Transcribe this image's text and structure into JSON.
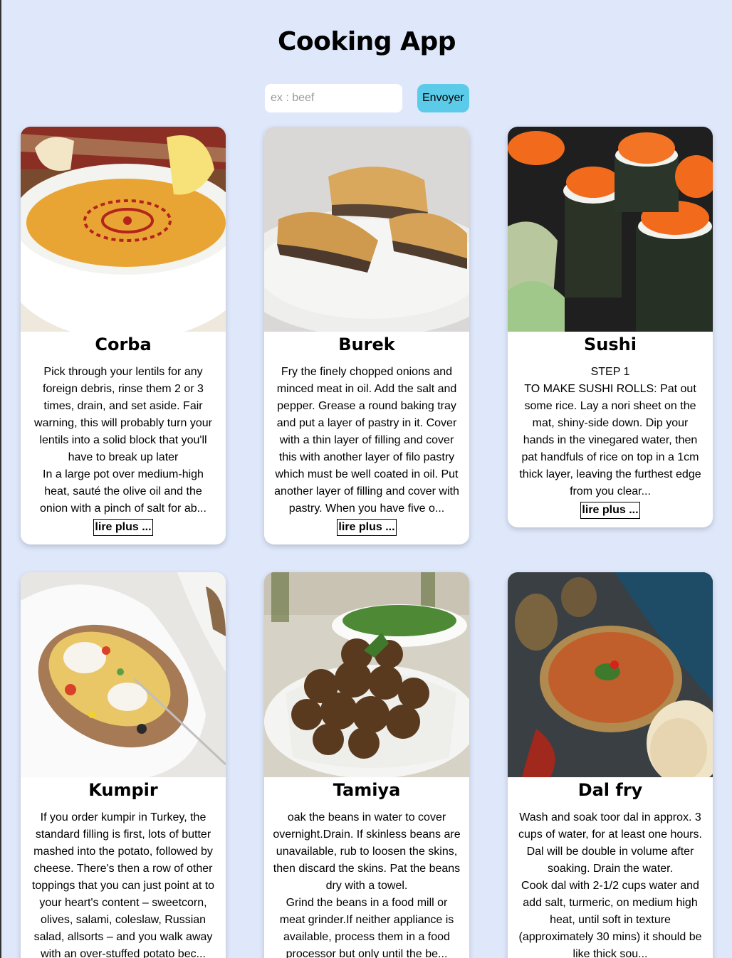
{
  "header": {
    "title": "Cooking App"
  },
  "search": {
    "placeholder": "ex : beef",
    "value": "",
    "button_label": "Envoyer"
  },
  "read_more_label": "lire plus ...",
  "recipes": [
    {
      "name": "Corba",
      "image": "lentil-soup-image",
      "text": "Pick through your lentils for any foreign debris, rinse them 2 or 3 times, drain, and set aside. Fair warning, this will probably turn your lentils into a solid block that you'll have to break up later\nIn a large pot over medium-high heat, sauté the olive oil and the onion with a pinch of salt for ab..."
    },
    {
      "name": "Burek",
      "image": "burek-pastry-image",
      "text": "Fry the finely chopped onions and minced meat in oil. Add the salt and pepper. Grease a round baking tray and put a layer of pastry in it. Cover with a thin layer of filling and cover this with another layer of filo pastry which must be well coated in oil. Put another layer of filling and cover with pastry. When you have five o..."
    },
    {
      "name": "Sushi",
      "image": "sushi-rolls-image",
      "text": "STEP 1\nTO MAKE SUSHI ROLLS: Pat out some rice. Lay a nori sheet on the mat, shiny-side down. Dip your hands in the vinegared water, then pat handfuls of rice on top in a 1cm thick layer, leaving the furthest edge from you clear..."
    },
    {
      "name": "Kumpir",
      "image": "kumpir-potato-image",
      "text": "If you order kumpir in Turkey, the standard filling is first, lots of butter mashed into the potato, followed by cheese. There's then a row of other toppings that you can just point at to your heart's content – sweetcorn, olives, salami, coleslaw, Russian salad, allsorts – and you walk away with an over-stuffed potato bec..."
    },
    {
      "name": "Tamiya",
      "image": "falafel-image",
      "text": "oak the beans in water to cover overnight.Drain. If skinless beans are unavailable, rub to loosen the skins, then discard the skins. Pat the beans dry with a towel.\nGrind the beans in a food mill or meat grinder.If neither appliance is available, process them in a food processor but only until the be..."
    },
    {
      "name": "Dal fry",
      "image": "dal-curry-image",
      "text": "Wash and soak toor dal in approx. 3 cups of water, for at least one hours. Dal will be double in volume after soaking. Drain the water.\nCook dal with 2-1/2 cups water and add salt, turmeric, on medium high heat, until soft in texture (approximately 30 mins) it should be like thick sou..."
    }
  ]
}
